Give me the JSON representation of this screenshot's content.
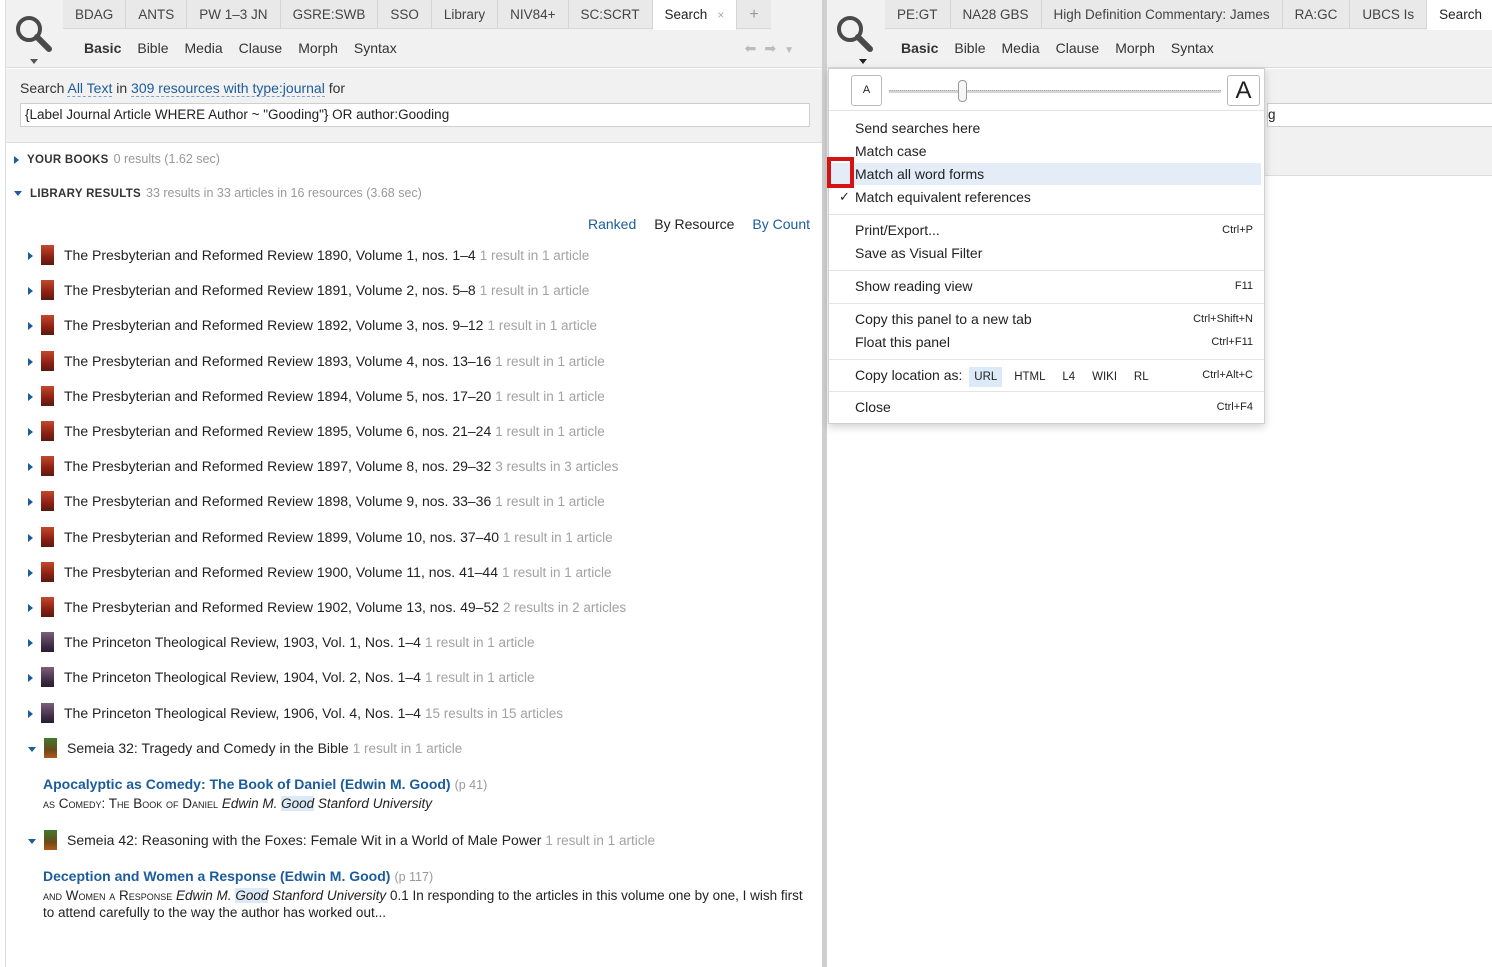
{
  "left": {
    "tabs": [
      "BDAG",
      "ANTS",
      "PW 1–3 JN",
      "GSRE:SWB",
      "SSO",
      "Library",
      "NIV84+",
      "SC:SCRT",
      "Search"
    ],
    "active_tab_close": "×",
    "add_tab": "+",
    "subtabs": [
      "Basic",
      "Bible",
      "Media",
      "Clause",
      "Morph",
      "Syntax"
    ],
    "search": {
      "prefix": "Search",
      "scope": "All Text",
      "mid": "in",
      "resources": "309 resources with type:journal",
      "suffix": "for",
      "query": "{Label Journal Article WHERE Author ~ \"Gooding\"} OR author:Gooding"
    },
    "your_books": {
      "label": "YOUR BOOKS",
      "meta": "0 results (1.62 sec)"
    },
    "library_results": {
      "label": "LIBRARY RESULTS",
      "meta": "33 results in 33 articles in 16 resources (3.68 sec)"
    },
    "sort": {
      "ranked": "Ranked",
      "by_resource": "By Resource",
      "by_count": "By Count"
    },
    "results": [
      {
        "title": "The Presbyterian and Reformed Review 1890, Volume 1, nos. 1–4",
        "meta": "1 result in 1 article",
        "icon": "presby"
      },
      {
        "title": "The Presbyterian and Reformed Review 1891, Volume 2, nos. 5–8",
        "meta": "1 result in 1 article",
        "icon": "presby"
      },
      {
        "title": "The Presbyterian and Reformed Review 1892, Volume 3, nos. 9–12",
        "meta": "1 result in 1 article",
        "icon": "presby"
      },
      {
        "title": "The Presbyterian and Reformed Review 1893, Volume 4, nos. 13–16",
        "meta": "1 result in 1 article",
        "icon": "presby"
      },
      {
        "title": "The Presbyterian and Reformed Review 1894, Volume 5, nos. 17–20",
        "meta": "1 result in 1 article",
        "icon": "presby"
      },
      {
        "title": "The Presbyterian and Reformed Review 1895, Volume 6, nos. 21–24",
        "meta": "1 result in 1 article",
        "icon": "presby"
      },
      {
        "title": "The Presbyterian and Reformed Review 1897, Volume 8, nos. 29–32",
        "meta": "3 results in 3 articles",
        "icon": "presby"
      },
      {
        "title": "The Presbyterian and Reformed Review 1898, Volume 9, nos. 33–36",
        "meta": "1 result in 1 article",
        "icon": "presby"
      },
      {
        "title": "The Presbyterian and Reformed Review 1899, Volume 10, nos. 37–40",
        "meta": "1 result in 1 article",
        "icon": "presby"
      },
      {
        "title": "The Presbyterian and Reformed Review 1900, Volume 11, nos. 41–44",
        "meta": "1 result in 1 article",
        "icon": "presby"
      },
      {
        "title": "The Presbyterian and Reformed Review 1902, Volume 13, nos. 49–52",
        "meta": "2 results in 2 articles",
        "icon": "presby"
      },
      {
        "title": "The Princeton Theological Review, 1903, Vol. 1, Nos. 1–4",
        "meta": "1 result in 1 article",
        "icon": "princeton"
      },
      {
        "title": "The Princeton Theological Review, 1904, Vol. 2, Nos. 1–4",
        "meta": "1 result in 1 article",
        "icon": "princeton"
      },
      {
        "title": "The Princeton Theological Review, 1906, Vol. 4, Nos. 1–4",
        "meta": "15 results in 15 articles",
        "icon": "princeton"
      }
    ],
    "semeia32": {
      "title": "Semeia 32: Tragedy and Comedy in the Bible",
      "meta": "1 result in 1 article",
      "article_title": "Apocalyptic as Comedy: The Book of Daniel (Edwin M. Good)",
      "page": "(p 41)",
      "snip_sc": "as Comedy: The Book of Daniel",
      "snip_author": "Edwin M.",
      "snip_hl": "Good",
      "snip_rest": "Stanford University"
    },
    "semeia42": {
      "title": "Semeia 42: Reasoning with the Foxes: Female Wit in a World of Male Power",
      "meta": "1 result in 1 article",
      "article_title": "Deception and Women a Response (Edwin M. Good)",
      "page": "(p 117)",
      "snip_sc": "and Women a Response",
      "snip_author": "Edwin M.",
      "snip_hl": "Good",
      "snip_univ": "Stanford University",
      "snip_rest": "0.1 In responding to the articles in this volume one by one, I wish first to attend carefully to the way the author has worked out..."
    }
  },
  "right": {
    "tabs": [
      "PE:GT",
      "NA28 GBS",
      "High Definition Commentary: James",
      "RA:GC",
      "UBCS Is",
      "Search"
    ],
    "active_tab_close": "×",
    "subtabs": [
      "Basic",
      "Bible",
      "Media",
      "Clause",
      "Morph",
      "Syntax"
    ],
    "query_tail": "g",
    "menu": {
      "font_small": "A",
      "font_large": "A",
      "slider_level_fraction": 0.22,
      "send_searches": "Send searches here",
      "match_case": "Match case",
      "match_word_forms": "Match all word forms",
      "match_refs": "Match equivalent references",
      "check": "✓",
      "print_export": "Print/Export...",
      "print_key": "Ctrl+P",
      "save_visual": "Save as Visual Filter",
      "reading_view": "Show reading view",
      "reading_key": "F11",
      "copy_panel": "Copy this panel to a new tab",
      "copy_panel_key": "Ctrl+Shift+N",
      "float_panel": "Float this panel",
      "float_key": "Ctrl+F11",
      "copy_location": "Copy location as:",
      "copy_opts": [
        "URL",
        "HTML",
        "L4",
        "WIKI",
        "RL"
      ],
      "copy_key": "Ctrl+Alt+C",
      "close": "Close",
      "close_key": "Ctrl+F4"
    }
  },
  "colors": {
    "link": "#1c5c9c",
    "highlight_box": "#d41414",
    "menu_hover": "#e3ecf7"
  },
  "icons": [
    "search-icon",
    "chevron-down-icon",
    "back-arrow-icon",
    "forward-arrow-icon",
    "close-icon",
    "plus-icon",
    "book-cover-icon",
    "checkmark-icon"
  ]
}
